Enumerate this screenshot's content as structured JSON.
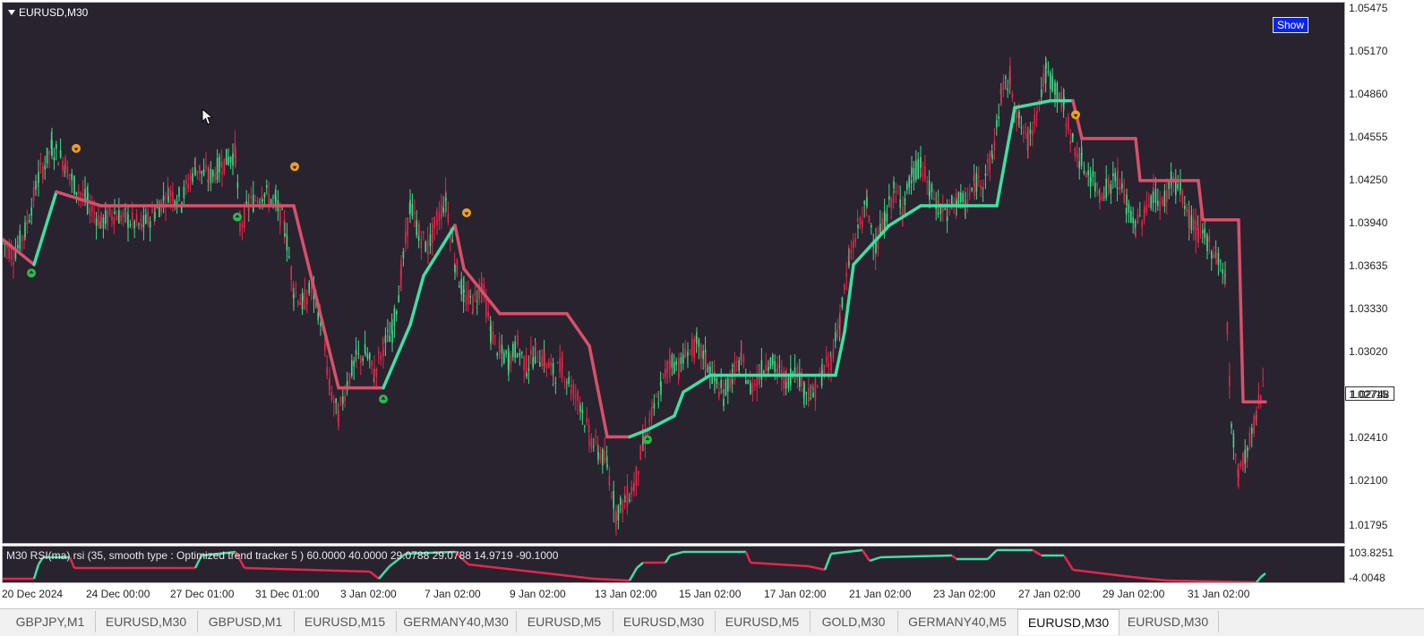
{
  "chart": {
    "symbol_label": "EURUSD,M30",
    "show_button": "Show",
    "current_price": "1.02748",
    "price_labels": [
      "1.05475",
      "1.05170",
      "1.04860",
      "1.04555",
      "1.04250",
      "1.03940",
      "1.03635",
      "1.03330",
      "1.03020",
      "1.02715",
      "1.02410",
      "1.02100",
      "1.01795"
    ],
    "indicator_label": "M30 RSI(ma) rsi (35, smooth type : Optimized trend tracker  5 ) 60.0000 40.0000 29.0788 29.0788 14.9719 -90.1000",
    "indicator_scale": [
      "103.8251",
      "-4.0048"
    ],
    "time_labels": [
      "20 Dec 2024",
      "24 Dec 00:00",
      "27 Dec 01:00",
      "31 Dec 01:00",
      "3 Jan 02:00",
      "7 Jan 02:00",
      "9 Jan 02:00",
      "13 Jan 02:00",
      "15 Jan 02:00",
      "17 Jan 02:00",
      "21 Jan 02:00",
      "23 Jan 02:00",
      "27 Jan 02:00",
      "29 Jan 02:00",
      "31 Jan 02:00"
    ],
    "colors": {
      "background": "#28232f",
      "bull": "#3ddc84",
      "bear": "#e8254a",
      "trend_up": "#3fe0a0",
      "trend_down": "#d9506a",
      "signal_up": "#2fb84a",
      "signal_down": "#f0a020"
    }
  },
  "chart_data": {
    "type": "line",
    "title": "EURUSD,M30",
    "ylim": [
      1.0168,
      1.0555
    ],
    "series": [
      {
        "name": "price",
        "points": [
          [
            0,
            1.0385
          ],
          [
            12,
            1.0375
          ],
          [
            25,
            1.0392
          ],
          [
            40,
            1.043
          ],
          [
            55,
            1.0452
          ],
          [
            70,
            1.044
          ],
          [
            80,
            1.0425
          ],
          [
            95,
            1.0412
          ],
          [
            110,
            1.0398
          ],
          [
            125,
            1.0405
          ],
          [
            140,
            1.04
          ],
          [
            155,
            1.0395
          ],
          [
            170,
            1.0405
          ],
          [
            185,
            1.042
          ],
          [
            200,
            1.0415
          ],
          [
            215,
            1.0438
          ],
          [
            230,
            1.043
          ],
          [
            245,
            1.044
          ],
          [
            260,
            1.0448
          ],
          [
            265,
            1.0395
          ],
          [
            275,
            1.041
          ],
          [
            290,
            1.042
          ],
          [
            305,
            1.0412
          ],
          [
            315,
            1.0395
          ],
          [
            325,
            1.035
          ],
          [
            335,
            1.034
          ],
          [
            345,
            1.0352
          ],
          [
            355,
            1.033
          ],
          [
            365,
            1.028
          ],
          [
            375,
            1.026
          ],
          [
            385,
            1.0285
          ],
          [
            395,
            1.03
          ],
          [
            405,
            1.0305
          ],
          [
            415,
            1.029
          ],
          [
            425,
            1.031
          ],
          [
            435,
            1.032
          ],
          [
            445,
            1.036
          ],
          [
            455,
            1.041
          ],
          [
            465,
            1.039
          ],
          [
            475,
            1.038
          ],
          [
            485,
            1.04
          ],
          [
            495,
            1.0415
          ],
          [
            505,
            1.037
          ],
          [
            515,
            1.0345
          ],
          [
            525,
            1.034
          ],
          [
            535,
            1.0355
          ],
          [
            545,
            1.032
          ],
          [
            555,
            1.0305
          ],
          [
            565,
            1.03
          ],
          [
            575,
            1.031
          ],
          [
            585,
            1.0295
          ],
          [
            595,
            1.0305
          ],
          [
            605,
            1.03
          ],
          [
            615,
            1.029
          ],
          [
            625,
            1.0295
          ],
          [
            635,
            1.028
          ],
          [
            645,
            1.027
          ],
          [
            655,
            1.0245
          ],
          [
            665,
            1.0235
          ],
          [
            675,
            1.0225
          ],
          [
            685,
            1.019
          ],
          [
            695,
            1.02
          ],
          [
            705,
            1.021
          ],
          [
            715,
            1.024
          ],
          [
            725,
            1.026
          ],
          [
            735,
            1.028
          ],
          [
            745,
            1.03
          ],
          [
            755,
            1.0295
          ],
          [
            765,
            1.0305
          ],
          [
            775,
            1.031
          ],
          [
            785,
            1.03
          ],
          [
            795,
            1.0285
          ],
          [
            805,
            1.0275
          ],
          [
            815,
            1.029
          ],
          [
            825,
            1.03
          ],
          [
            835,
            1.028
          ],
          [
            845,
            1.029
          ],
          [
            855,
            1.03
          ],
          [
            865,
            1.0292
          ],
          [
            875,
            1.0285
          ],
          [
            885,
            1.0295
          ],
          [
            895,
            1.028
          ],
          [
            905,
            1.0275
          ],
          [
            915,
            1.029
          ],
          [
            925,
            1.03
          ],
          [
            935,
            1.033
          ],
          [
            945,
            1.037
          ],
          [
            955,
            1.0395
          ],
          [
            965,
            1.041
          ],
          [
            975,
            1.038
          ],
          [
            985,
            1.04
          ],
          [
            995,
            1.042
          ],
          [
            1005,
            1.041
          ],
          [
            1015,
            1.043
          ],
          [
            1025,
            1.044
          ],
          [
            1035,
            1.042
          ],
          [
            1045,
            1.041
          ],
          [
            1055,
            1.0405
          ],
          [
            1065,
            1.0415
          ],
          [
            1075,
            1.041
          ],
          [
            1085,
            1.0425
          ],
          [
            1095,
            1.043
          ],
          [
            1105,
            1.0445
          ],
          [
            1115,
            1.049
          ],
          [
            1125,
            1.05
          ],
          [
            1135,
            1.047
          ],
          [
            1145,
            1.0455
          ],
          [
            1155,
            1.048
          ],
          [
            1165,
            1.0505
          ],
          [
            1175,
            1.0495
          ],
          [
            1185,
            1.048
          ],
          [
            1195,
            1.0455
          ],
          [
            1205,
            1.044
          ],
          [
            1215,
            1.043
          ],
          [
            1225,
            1.042
          ],
          [
            1235,
            1.0425
          ],
          [
            1245,
            1.043
          ],
          [
            1255,
            1.041
          ],
          [
            1265,
            1.0395
          ],
          [
            1275,
            1.0405
          ],
          [
            1285,
            1.042
          ],
          [
            1295,
            1.041
          ],
          [
            1305,
            1.043
          ],
          [
            1315,
            1.042
          ],
          [
            1325,
            1.04
          ],
          [
            1335,
            1.039
          ],
          [
            1345,
            1.0385
          ],
          [
            1355,
            1.0375
          ],
          [
            1365,
            1.036
          ],
          [
            1372,
            1.025
          ],
          [
            1380,
            1.022
          ],
          [
            1390,
            1.0235
          ],
          [
            1400,
            1.026
          ],
          [
            1408,
            1.029
          ]
        ]
      },
      {
        "name": "trend",
        "points": [
          [
            0,
            1.0386
          ],
          [
            35,
            1.0368
          ],
          [
            60,
            1.042
          ],
          [
            110,
            1.041
          ],
          [
            265,
            1.041
          ],
          [
            325,
            1.041
          ],
          [
            375,
            1.028
          ],
          [
            425,
            1.028
          ],
          [
            455,
            1.0325
          ],
          [
            470,
            1.036
          ],
          [
            505,
            1.0396
          ],
          [
            515,
            1.0365
          ],
          [
            555,
            1.0333
          ],
          [
            630,
            1.0333
          ],
          [
            655,
            1.031
          ],
          [
            675,
            1.0245
          ],
          [
            700,
            1.0245
          ],
          [
            720,
            1.025
          ],
          [
            750,
            1.026
          ],
          [
            760,
            1.0277
          ],
          [
            790,
            1.0289
          ],
          [
            930,
            1.0289
          ],
          [
            940,
            1.032
          ],
          [
            950,
            1.0368
          ],
          [
            990,
            1.0396
          ],
          [
            1025,
            1.041
          ],
          [
            1110,
            1.041
          ],
          [
            1130,
            1.048
          ],
          [
            1170,
            1.0485
          ],
          [
            1195,
            1.0485
          ],
          [
            1205,
            1.0458
          ],
          [
            1265,
            1.0458
          ],
          [
            1270,
            1.0428
          ],
          [
            1335,
            1.0428
          ],
          [
            1340,
            1.04
          ],
          [
            1380,
            1.04
          ],
          [
            1385,
            1.027
          ],
          [
            1410,
            1.027
          ]
        ]
      }
    ]
  },
  "tabs": [
    {
      "label": "GBPJPY,M1",
      "active": false
    },
    {
      "label": "EURUSD,M30",
      "active": false
    },
    {
      "label": "GBPUSD,M1",
      "active": false
    },
    {
      "label": "EURUSD,M15",
      "active": false
    },
    {
      "label": "GERMANY40,M30",
      "active": false
    },
    {
      "label": "EURUSD,M5",
      "active": false
    },
    {
      "label": "EURUSD,M30",
      "active": false
    },
    {
      "label": "EURUSD,M5",
      "active": false
    },
    {
      "label": "GOLD,M30",
      "active": false
    },
    {
      "label": "GERMANY40,M5",
      "active": false
    },
    {
      "label": "EURUSD,M30",
      "active": true
    },
    {
      "label": "EURUSD,M30",
      "active": false
    }
  ]
}
